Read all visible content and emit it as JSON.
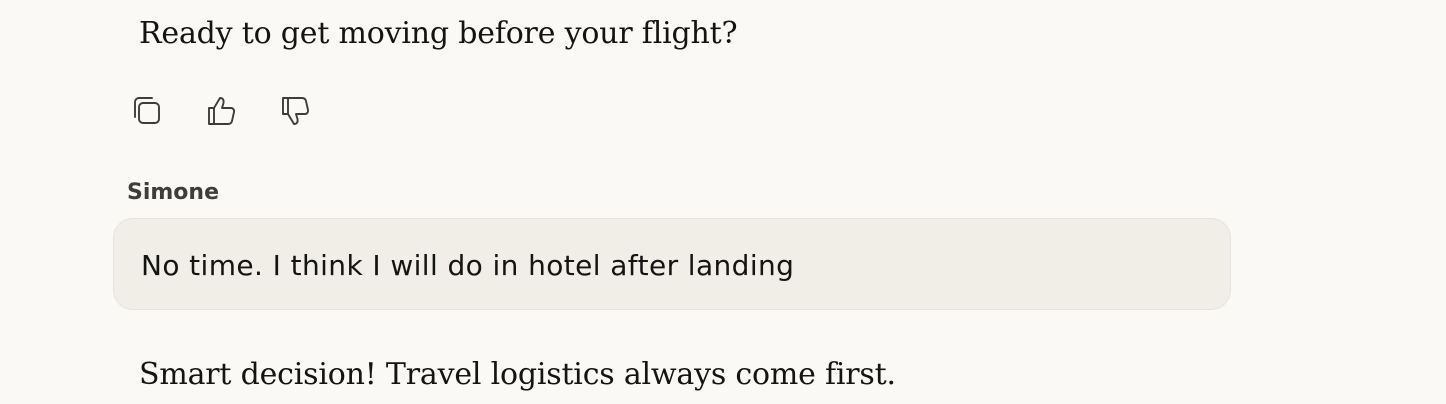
{
  "conversation": {
    "assistant_message_1": "Ready to get moving before your flight?",
    "actions": [
      {
        "icon": "copy-icon"
      },
      {
        "icon": "thumbs-up-icon"
      },
      {
        "icon": "thumbs-down-icon"
      }
    ],
    "user_sender": "Simone",
    "user_message": "No time. I think I will do in hotel after landing",
    "assistant_message_2": "Smart decision! Travel logistics always come first."
  },
  "colors": {
    "background": "#faf9f5",
    "user_bubble": "#f0eee6",
    "text": "#141413",
    "icon": "#3d3d3a"
  }
}
